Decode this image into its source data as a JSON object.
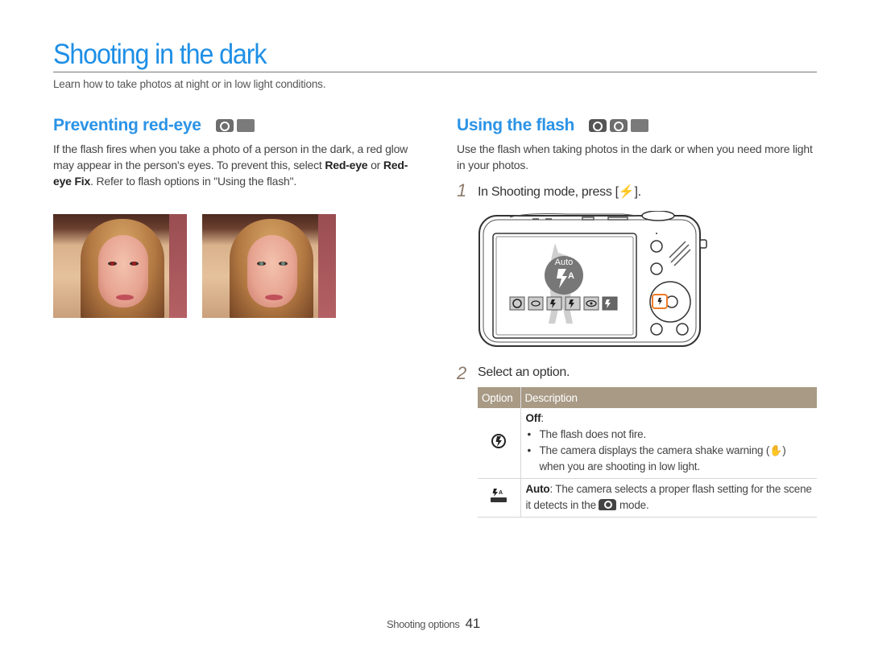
{
  "header": {
    "title": "Shooting in the dark",
    "intro": "Learn how to take photos at night or in low light conditions."
  },
  "red_eye": {
    "heading": "Preventing red-eye",
    "mode_icons": [
      "program-mode-icon",
      "scene-mode-icon"
    ],
    "text_1": "If the flash fires when you take a photo of a person in the dark, a red glow may appear in the person's eyes. To prevent this, select ",
    "bold_1": "Red-eye",
    "text_2": " or ",
    "bold_2": "Red-eye Fix",
    "text_3": ". Refer to flash options in \"Using the flash\".",
    "photos": [
      {
        "name": "red-eye-photo",
        "iris_color": "#9e1e1e"
      },
      {
        "name": "corrected-photo",
        "iris_color": "#6d8a7c"
      }
    ]
  },
  "flash": {
    "heading": "Using the flash",
    "mode_icons": [
      "smart-auto-mode-icon",
      "program-mode-icon",
      "scene-mode-icon"
    ],
    "intro": "Use the flash when taking photos in the dark or when you need more light in your photos.",
    "steps": [
      {
        "num": "1",
        "text_before": "In Shooting mode, press [",
        "key": "⚡",
        "text_after": "]."
      },
      {
        "num": "2",
        "text": "Select an option."
      }
    ],
    "camera_screen": {
      "selected_label": "Auto",
      "options": [
        "off",
        "red-eye-fix",
        "slow-sync",
        "fill-in",
        "red-eye",
        "auto"
      ],
      "selected_index": 5,
      "highlight_color": "#f07a2a"
    },
    "table": {
      "headers": [
        "Option",
        "Description"
      ],
      "header_color": "#a89a85",
      "rows": [
        {
          "icon": "flash-off-icon",
          "title": "Off",
          "bullets": [
            "The flash does not fire.",
            "The camera displays the camera shake warning ( ) when you are shooting in low light."
          ],
          "bullet_2_before": "The camera displays the camera shake warning (",
          "bullet_2_after": ") when you are shooting in low light."
        },
        {
          "icon": "flash-auto-smart-icon",
          "title": "Auto",
          "desc_before": ": The camera selects a proper flash setting for the scene it detects in the ",
          "desc_after": " mode."
        }
      ]
    }
  },
  "footer": {
    "section": "Shooting options",
    "page": "41"
  },
  "colors": {
    "title_blue": "#1e8fe6",
    "heading_blue": "#2b93e6"
  }
}
